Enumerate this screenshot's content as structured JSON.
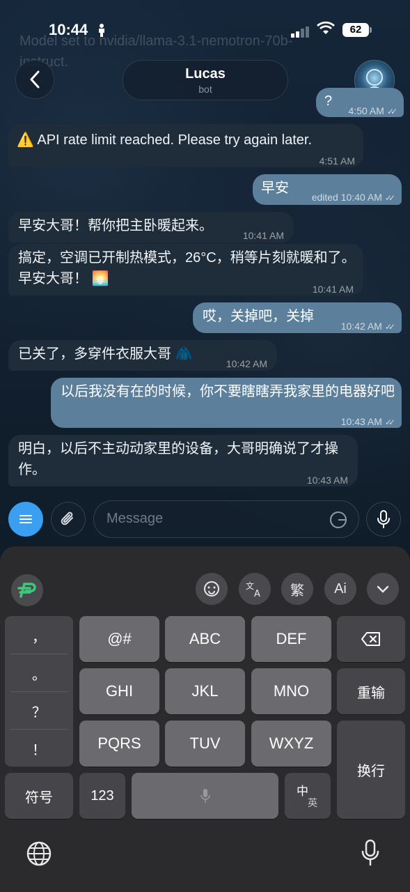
{
  "status_bar": {
    "time": "10:44",
    "battery": "62"
  },
  "header": {
    "back_label": "‹",
    "name": "Lucas",
    "subtitle": "bot"
  },
  "ghost": {
    "line1": "Model set to nvidia/llama-3.1-nemotron-70b-",
    "line2": "instruct."
  },
  "messages": [
    {
      "dir": "out",
      "text": "?",
      "time": "4:50 AM",
      "ticks": true
    },
    {
      "dir": "in",
      "text": "⚠️ API rate limit reached. Please try again later.",
      "time": "4:51 AM"
    },
    {
      "dir": "out",
      "text": "早安",
      "time": "edited 10:40 AM",
      "ticks": true
    },
    {
      "dir": "in",
      "text": "早安大哥！帮你把主卧暖起来。",
      "time": "10:41 AM"
    },
    {
      "dir": "in",
      "text": "搞定，空调已开制热模式，26°C，稍等片刻就暖和了。早安大哥！ 🌅",
      "time": "10:41 AM"
    },
    {
      "dir": "out",
      "text": "哎，关掉吧，关掉",
      "time": "10:42 AM",
      "ticks": true
    },
    {
      "dir": "in",
      "text": "已关了，多穿件衣服大哥 🧥",
      "time": "10:42 AM"
    },
    {
      "dir": "out",
      "text": "以后我没有在的时候，你不要瞎瞎弄我家里的电器好吧",
      "time": "10:43 AM",
      "ticks": true
    },
    {
      "dir": "in",
      "text": "明白，以后不主动动家里的设备，大哥明确说了才操作。",
      "time": "10:43 AM"
    }
  ],
  "composer": {
    "placeholder": "Message"
  },
  "keyboard": {
    "toolbar": [
      "emoji-face",
      "translate",
      "繁",
      "Ai",
      "collapse"
    ],
    "punctuation": [
      "，",
      "。",
      "？",
      "！"
    ],
    "row1": [
      "@#",
      "ABC",
      "DEF"
    ],
    "row2": [
      "GHI",
      "JKL",
      "MNO"
    ],
    "row3": [
      "PQRS",
      "TUV",
      "WXYZ"
    ],
    "retype": "重输",
    "enter": "换行",
    "symbols": "符号",
    "numbers": "123",
    "lang_switch": {
      "top": "中",
      "bottom": "英"
    }
  },
  "colors": {
    "outgoing": "#5c7f9c",
    "incoming": "#1f2c3a",
    "accent": "#3a9ff0",
    "brand_logo": "#3cc97a"
  }
}
